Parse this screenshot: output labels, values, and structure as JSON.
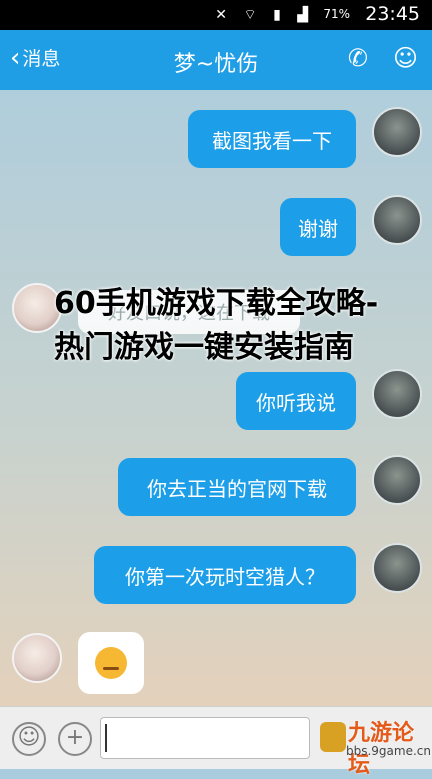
{
  "status_bar": {
    "battery_percent": "71%",
    "time": "23:45"
  },
  "header": {
    "back_label": "消息",
    "title": "梦~忧伤"
  },
  "messages": [
    {
      "side": "sent",
      "text": "截图我看一下"
    },
    {
      "side": "sent",
      "text": "谢谢"
    },
    {
      "side": "received",
      "text": "好友口说，这在下载"
    },
    {
      "side": "sent",
      "text": "你听我说"
    },
    {
      "side": "sent",
      "text": "你去正当的官网下载"
    },
    {
      "side": "sent",
      "text": "你第一次玩时空猎人？"
    },
    {
      "side": "received",
      "text": ""
    }
  ],
  "overlay_title": "60手机游戏下载全攻略-热门游戏一键安装指南",
  "watermark": {
    "name": "九游论坛",
    "url": "bbs.9game.cn"
  },
  "colors": {
    "accent": "#1f9ee6",
    "bubble_sent": "#1c9fe8",
    "bubble_received": "#ffffff"
  }
}
